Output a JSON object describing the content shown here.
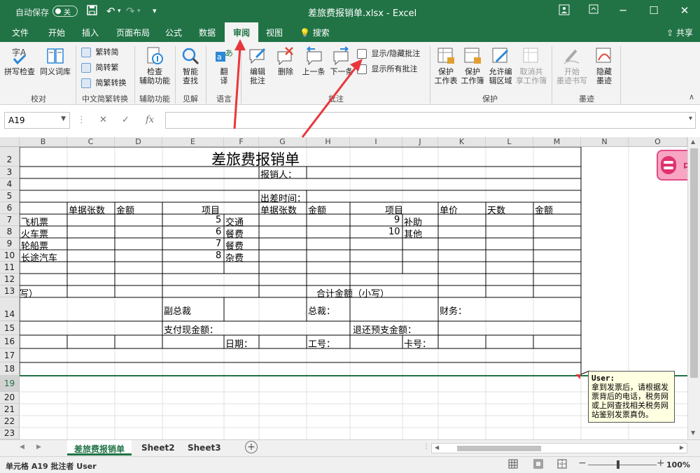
{
  "titlebar": {
    "autosave_label": "自动保存",
    "autosave_state": "关",
    "title": "差旅费报销单.xlsx  -  Excel"
  },
  "tabs": [
    "文件",
    "开始",
    "插入",
    "页面布局",
    "公式",
    "数据",
    "审阅",
    "视图",
    "搜索"
  ],
  "active_tab": "审阅",
  "share": "共享",
  "ribbon": {
    "proofing": {
      "spell": "拼写检查",
      "thesaurus": "同义词库",
      "group": "校对"
    },
    "chinese": {
      "t2s": "繁转简",
      "s2t": "简转繁",
      "convert": "简繁转换",
      "group": "中文简繁转换"
    },
    "access": {
      "btn1": "检查",
      "btn2": "辅助功能",
      "group": "辅助功能"
    },
    "insights": {
      "btn1": "智能",
      "btn2": "查找",
      "group": "见解"
    },
    "language": {
      "btn1": "翻",
      "btn2": "译",
      "group": "语言"
    },
    "comments": {
      "edit1": "编辑",
      "edit2": "批注",
      "delete": "删除",
      "prev": "上一条",
      "next": "下一条",
      "show_hide": "显示/隐藏批注",
      "show_all": "显示所有批注",
      "group": "批注"
    },
    "protect": {
      "sheet1": "保护",
      "sheet2": "工作表",
      "wb1": "保护",
      "wb2": "工作簿",
      "edit1": "允许编",
      "edit2": "辑区域",
      "unshare1": "取消共",
      "unshare2": "享工作簿",
      "group": "保护"
    },
    "ink": {
      "start1": "开始",
      "start2": "墨迹书写",
      "hide1": "隐藏",
      "hide2": "墨迹",
      "group": "墨迹"
    }
  },
  "formula_bar": {
    "name_box": "A19",
    "fx": "fx",
    "cancel": "✕",
    "enter": "✓"
  },
  "columns": [
    "B",
    "C",
    "D",
    "E",
    "F",
    "G",
    "H",
    "I",
    "J",
    "K",
    "L",
    "M",
    "N",
    "O"
  ],
  "rows": [
    "2",
    "3",
    "4",
    "5",
    "6",
    "7",
    "8",
    "9",
    "10",
    "11",
    "12",
    "13",
    "14",
    "15",
    "16",
    "17",
    "18",
    "19",
    "20",
    "21",
    "22",
    "23"
  ],
  "sheet": {
    "title": "差旅费报销单",
    "applicant": "报销人：",
    "trip_time": "出差时间：",
    "h_count": "单据张数",
    "h_amount": "金额",
    "h_item": "项目",
    "h_price": "单价",
    "h_days": "天数",
    "items_left": [
      "飞机票",
      "火车票",
      "轮船票",
      "长途汽车"
    ],
    "item_nums": [
      "5",
      "6",
      "7",
      "8"
    ],
    "items_mid": [
      "交通",
      "餐费",
      "餐费",
      "杂费"
    ],
    "item_nums_r": [
      "9",
      "10"
    ],
    "items_right": [
      "补助",
      "其他"
    ],
    "r13_left": "写）",
    "r13_total": "合计金额（小写）",
    "vp": "副总裁",
    "ceo": "总裁：",
    "finance": "财务：",
    "pay_cash": "支付现金额：",
    "refund": "退还预支金额：",
    "date": "日期：",
    "emp_id": "工号：",
    "card": "卡号："
  },
  "comment": {
    "author": "User:",
    "text": "拿到发票后，请根据发票背后的电话，税务网或上网查找相关税务网站鉴别发票真伪。"
  },
  "addin_label": "中",
  "sheet_tabs": [
    "差旅费报销单",
    "Sheet2",
    "Sheet3"
  ],
  "status": {
    "text": "单元格 A19 批注者 User",
    "zoom": "100%"
  },
  "colors": {
    "accent": "#217346",
    "arrow": "#e8373c"
  }
}
